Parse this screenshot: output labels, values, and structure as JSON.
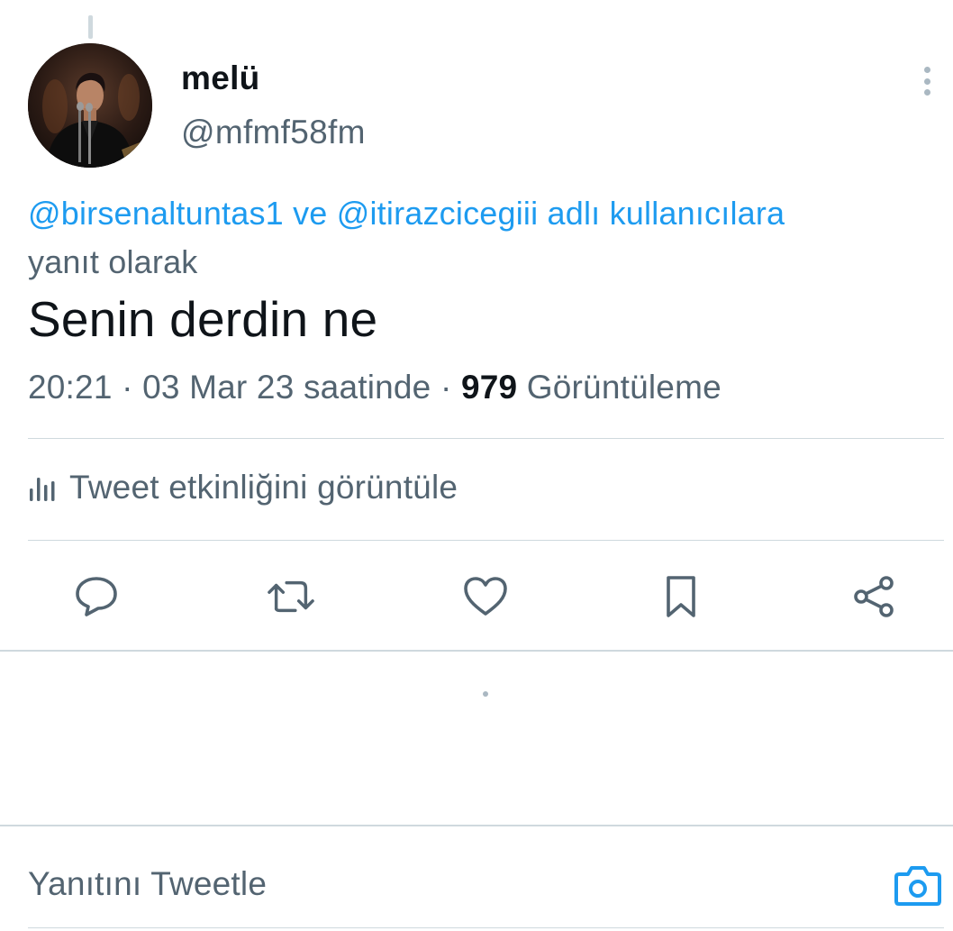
{
  "tweet": {
    "author": {
      "display_name": "melü",
      "handle": "@mfmf58fm",
      "avatar_icon": "profile-photo"
    },
    "reply_context": {
      "mention_1": "@birsenaltuntas1",
      "connector": "ve",
      "mention_2": "@itirazcicegiii",
      "suffix": "adlı kullanıcılara",
      "line2": "yanıt olarak"
    },
    "text": "Senin derdin ne",
    "meta": {
      "time": "20:21",
      "separator": "·",
      "date": "03 Mar 23 saatinde",
      "views_count": "979",
      "views_label": "Görüntüleme"
    },
    "activity_label": "Tweet etkinliğini görüntüle",
    "actions": [
      {
        "name": "reply",
        "icon": "reply-icon"
      },
      {
        "name": "retweet",
        "icon": "retweet-icon"
      },
      {
        "name": "like",
        "icon": "heart-icon"
      },
      {
        "name": "bookmark",
        "icon": "bookmark-icon"
      },
      {
        "name": "share",
        "icon": "share-icon"
      }
    ]
  },
  "reply_bar": {
    "placeholder": "Yanıtını Tweetle",
    "camera_icon": "camera-icon"
  },
  "colors": {
    "accent": "#1d9bf0",
    "text_primary": "#0f1419",
    "text_secondary": "#536471",
    "divider": "#cfd9de"
  }
}
